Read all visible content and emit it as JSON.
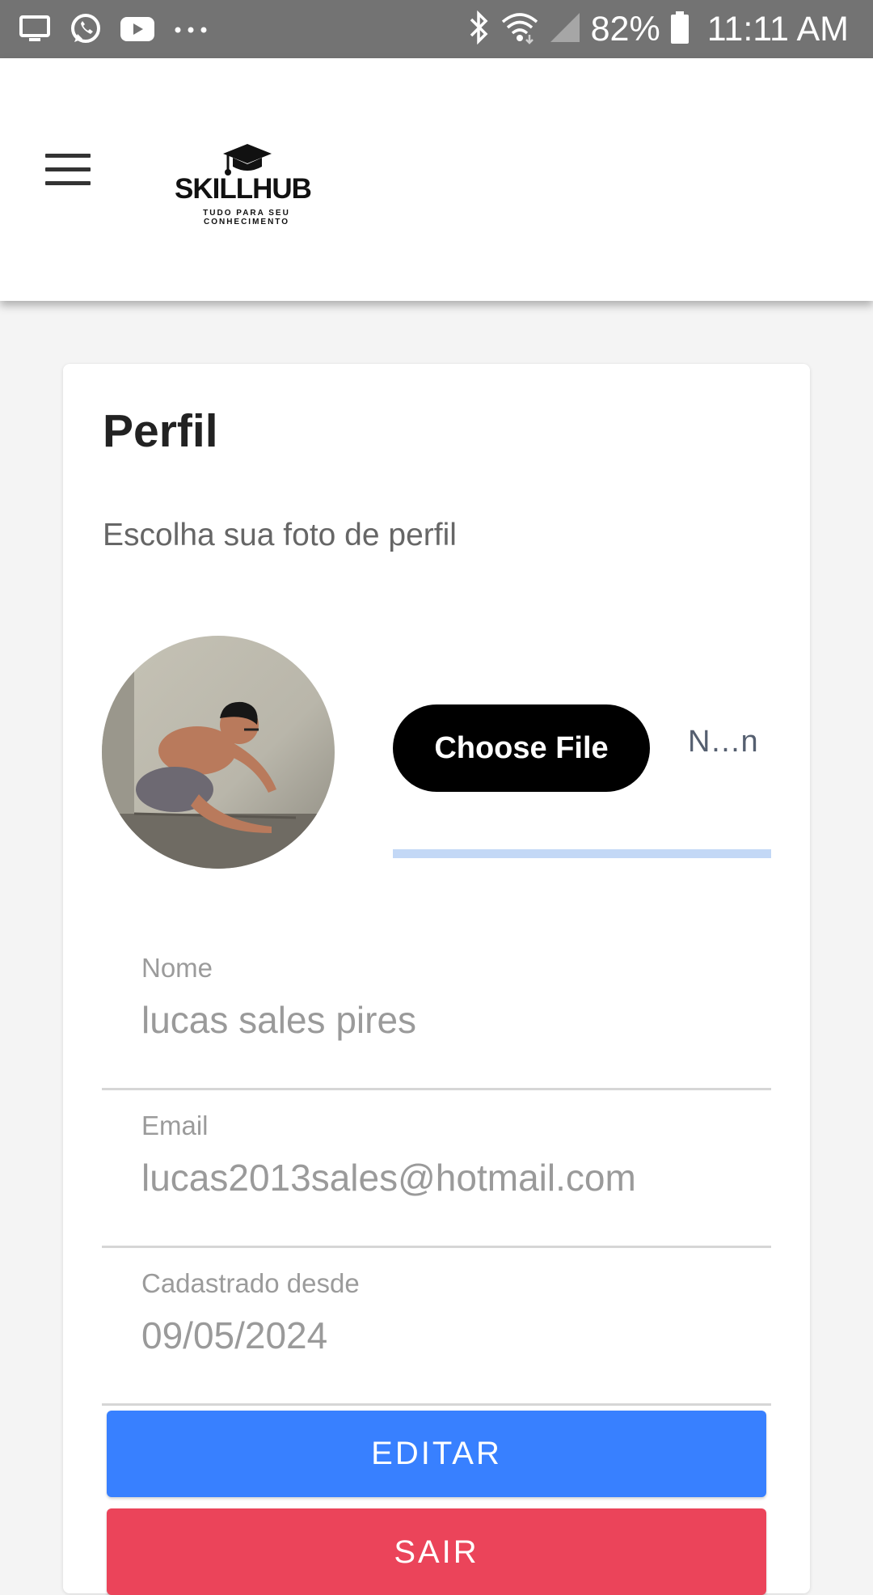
{
  "status_bar": {
    "left_icons": [
      "screen-cast-icon",
      "whatsapp-icon",
      "youtube-icon",
      "more-dots-icon"
    ],
    "right_icons": [
      "bluetooth-icon",
      "wifi-icon",
      "cell-signal-icon",
      "battery-icon"
    ],
    "battery_percent": "82%",
    "time": "11:11 AM"
  },
  "header": {
    "menu_icon": "hamburger-menu-icon",
    "logo_title": "SKILLHUB",
    "logo_tagline": "TUDO PARA SEU CONHECIMENTO"
  },
  "profile": {
    "title": "Perfil",
    "subtitle": "Escolha sua foto de perfil",
    "choose_file_label": "Choose File",
    "file_status": "N…n",
    "fields": [
      {
        "label": "Nome",
        "value": "lucas sales pires"
      },
      {
        "label": "Email",
        "value": "lucas2013sales@hotmail.com"
      },
      {
        "label": "Cadastrado desde",
        "value": "09/05/2024"
      }
    ],
    "edit_label": "EDITAR",
    "logout_label": "SAIR"
  },
  "colors": {
    "status_bar": "#737373",
    "primary": "#3880ff",
    "danger": "#eb445a",
    "file_button": "#000000",
    "file_underline": "#c3d8f6"
  }
}
